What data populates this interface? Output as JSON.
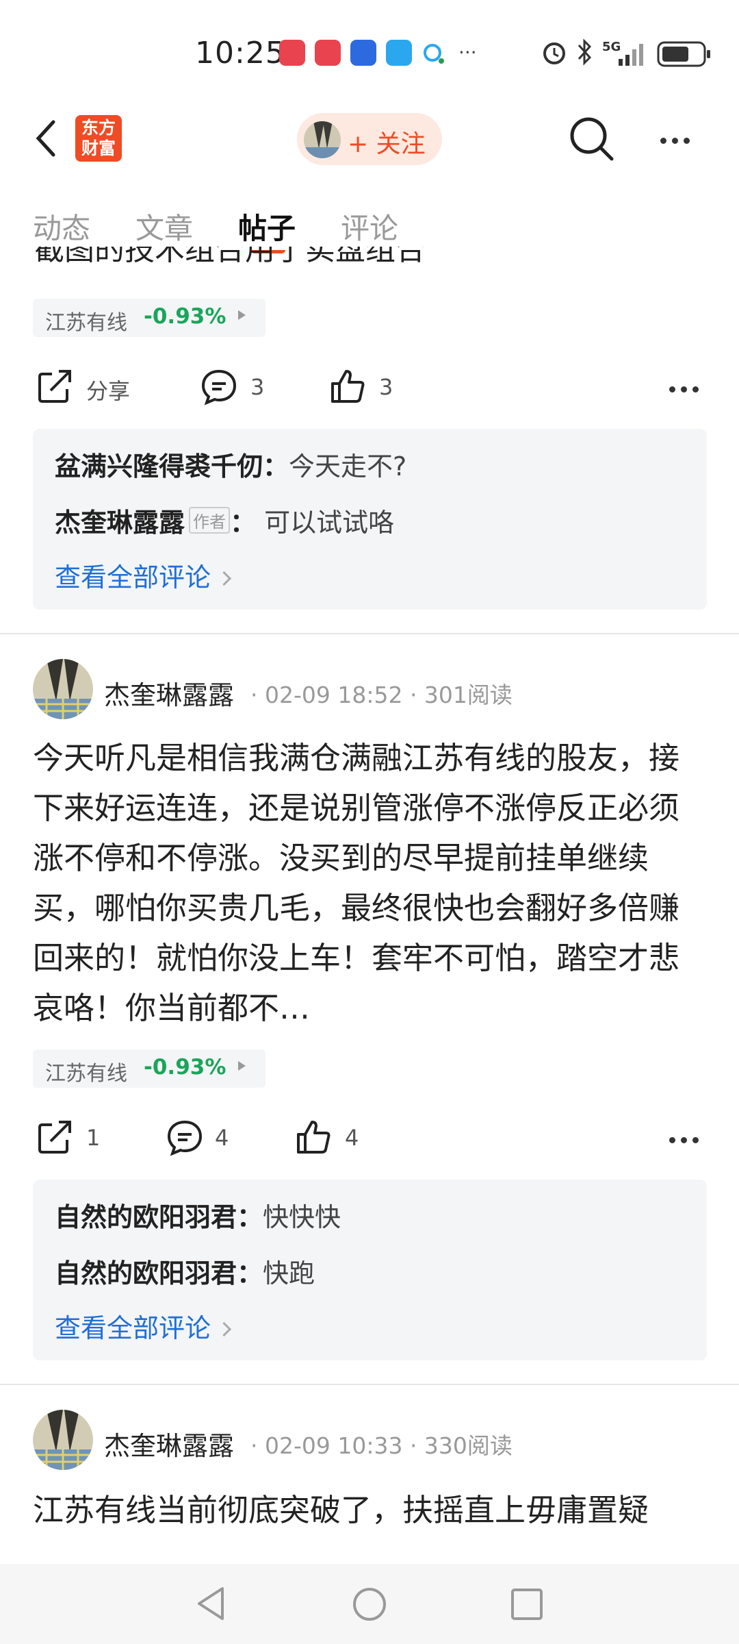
{
  "status_bar": {
    "time": "10:25",
    "network": "5G"
  },
  "header": {
    "logo_line1": "东方",
    "logo_line2": "财富",
    "follow_label": "+ 关注"
  },
  "tabs": [
    {
      "label": "动态",
      "active": false
    },
    {
      "label": "文章",
      "active": false
    },
    {
      "label": "帖子",
      "active": true
    },
    {
      "label": "评论",
      "active": false
    }
  ],
  "partial_text": "截图的技术组合用了实盘组合",
  "posts": [
    {
      "stock": {
        "name": "江苏有线",
        "change": "-0.93%"
      },
      "actions": {
        "share": "分享",
        "comments": "3",
        "likes": "3"
      },
      "comments": [
        {
          "user": "盆满兴隆得裘千仞",
          "author": false,
          "text": "今天走不?"
        },
        {
          "user": "杰奎琳露露",
          "author": true,
          "author_label": "作者",
          "text": "可以试试咯"
        }
      ],
      "view_all": "查看全部评论"
    },
    {
      "user": "杰奎琳露露",
      "meta": "· 02-09 18:52 · 301阅读",
      "body": "今天听凡是相信我满仓满融江苏有线的股友，接下来好运连连，还是说别管涨停不涨停反正必须涨不停和不停涨。没买到的尽早提前挂单继续买，哪怕你买贵几毛，最终很快也会翻好多倍赚回来的！就怕你没上车！套牢不可怕，踏空才悲哀咯！你当前都不…",
      "stock": {
        "name": "江苏有线",
        "change": "-0.93%"
      },
      "actions": {
        "share": "1",
        "comments": "4",
        "likes": "4"
      },
      "comments": [
        {
          "user": "自然的欧阳羽君",
          "author": false,
          "text": "快快快"
        },
        {
          "user": "自然的欧阳羽君",
          "author": false,
          "text": "快跑"
        }
      ],
      "view_all": "查看全部评论"
    },
    {
      "user": "杰奎琳露露",
      "meta": "· 02-09 10:33 · 330阅读",
      "body": "江苏有线当前彻底突破了，扶摇直上毋庸置疑"
    }
  ],
  "colors": {
    "accent": "#ef4b25",
    "down_green": "#1aa55a",
    "link_blue": "#1f6fd6"
  }
}
